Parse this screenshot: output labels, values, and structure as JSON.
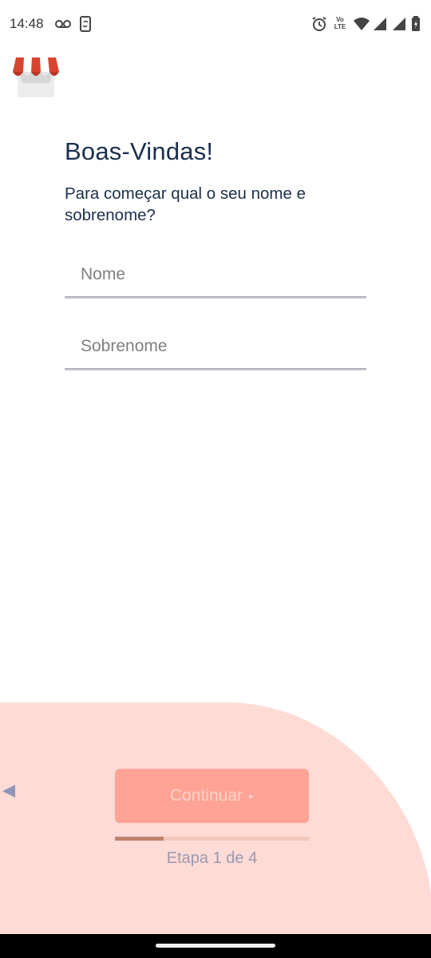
{
  "status_bar": {
    "time": "14:48",
    "network_label": "Vo LTE"
  },
  "header": {
    "logo_icon": "storefront-awning-icon"
  },
  "main": {
    "title": "Boas-Vindas!",
    "subtitle": "Para começar qual o seu nome e sobrenome?",
    "fields": [
      {
        "placeholder": "Nome",
        "value": ""
      },
      {
        "placeholder": "Sobrenome",
        "value": ""
      }
    ]
  },
  "footer": {
    "back_icon": "triangle-left-icon",
    "continue_label": "Continuar",
    "continue_arrow": "▸",
    "progress_fraction": 0.25,
    "step_label": "Etapa 1 de 4"
  },
  "colors": {
    "text_primary": "#1b2f4d",
    "button_bg": "#ffa394",
    "button_text": "#ffd2ca",
    "wave_bg": "#ffdbd6",
    "progress_track": "#f3c8bb",
    "progress_fill": "#c0836e",
    "step_text": "#9a99b0"
  }
}
